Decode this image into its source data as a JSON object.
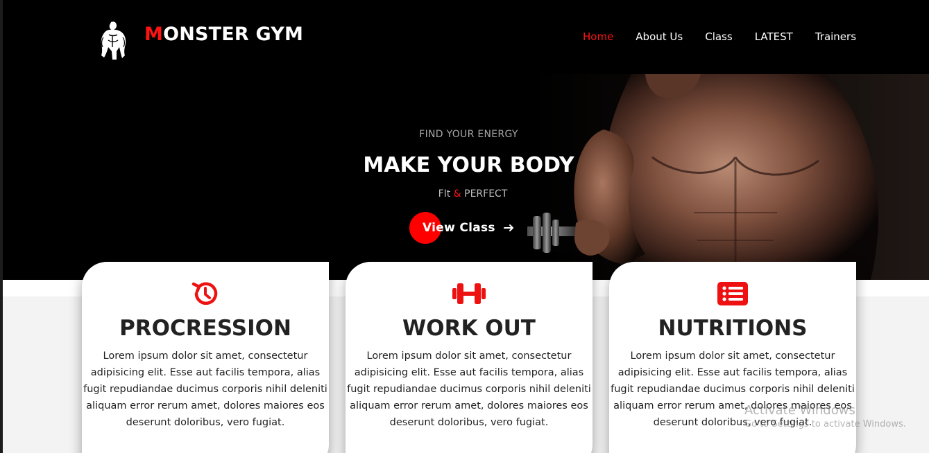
{
  "header": {
    "brand_first": "M",
    "brand_rest": "ONSTER GYM",
    "nav": [
      "Home",
      "About Us",
      "Class",
      "LATEST",
      "Trainers"
    ],
    "active_nav": "Home"
  },
  "hero": {
    "eyebrow": "FIND YOUR ENERGY",
    "headline": "MAKE YOUR BODY",
    "subline_left": "FIt",
    "subline_amp": "&",
    "subline_right": "PERFECT",
    "cta_label": "View Class"
  },
  "cards": [
    {
      "icon": "history-icon",
      "title": "PROCRESSION",
      "text": "Lorem ipsum dolor sit amet, consectetur adipisicing elit. Esse aut facilis tempora, alias fugit repudiandae ducimus corporis nihil deleniti aliquam error rerum amet, dolores maiores eos deserunt doloribus, vero fugiat."
    },
    {
      "icon": "dumbbell-icon",
      "title": "WORK OUT",
      "text": "Lorem ipsum dolor sit amet, consectetur adipisicing elit. Esse aut facilis tempora, alias fugit repudiandae ducimus corporis nihil deleniti aliquam error rerum amet, dolores maiores eos deserunt doloribus, vero fugiat."
    },
    {
      "icon": "list-icon",
      "title": "NUTRITIONS",
      "text": "Lorem ipsum dolor sit amet, consectetur adipisicing elit. Esse aut facilis tempora, alias fugit repudiandae ducimus corporis nihil deleniti aliquam error rerum amet, dolores maiores eos deserunt doloribus, vero fugiat."
    }
  ],
  "watermark": {
    "line1": "Activate Windows",
    "line2": "Go to Settings to activate Windows."
  },
  "colors": {
    "accent": "#ff1212",
    "header_bg": "#000000",
    "text_dark": "#222222"
  }
}
